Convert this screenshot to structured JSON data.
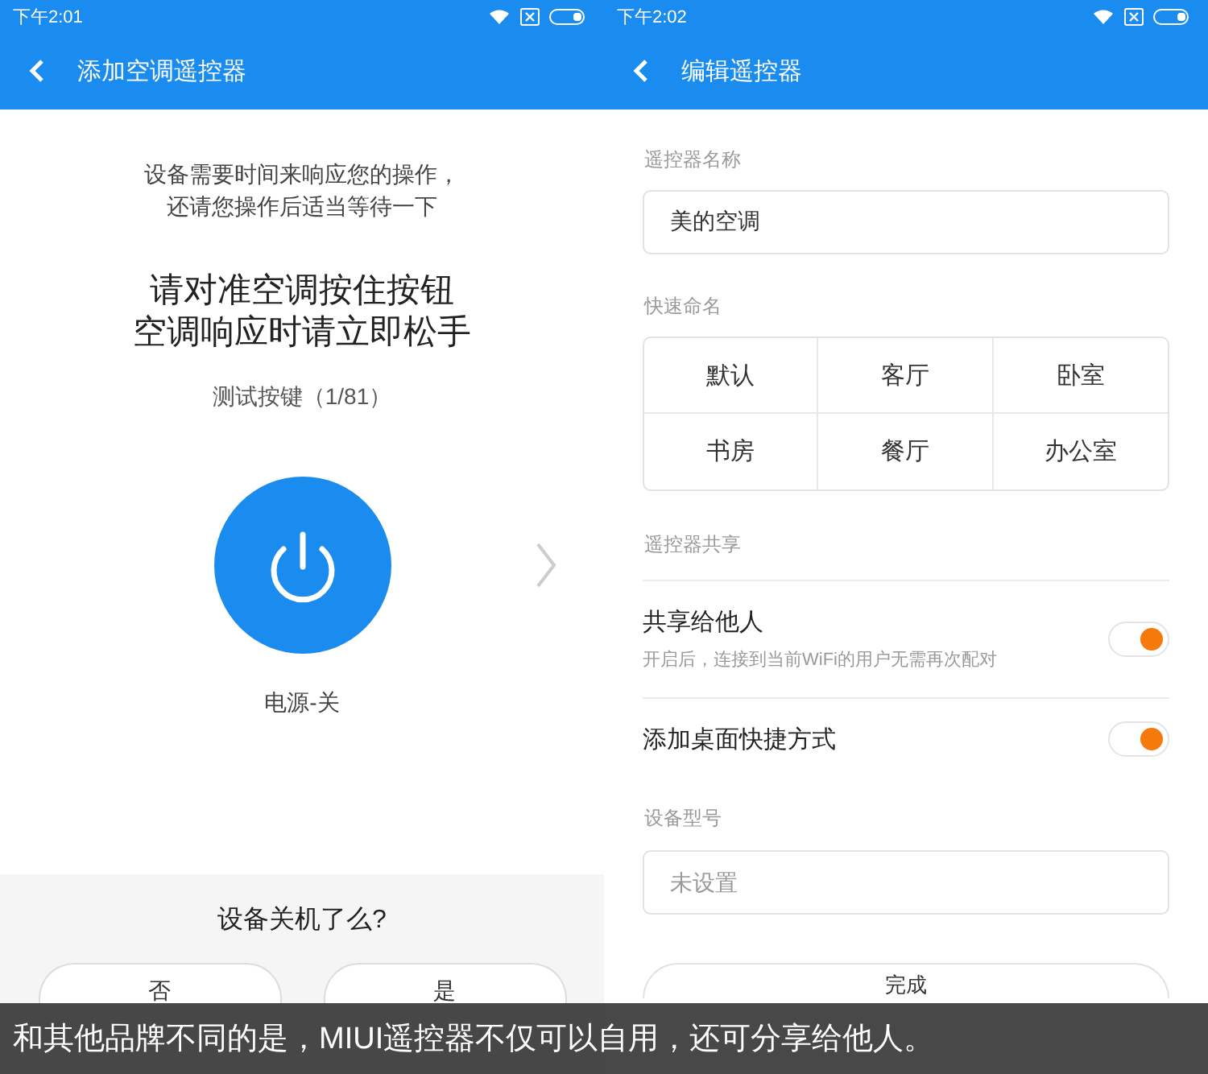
{
  "screens": [
    {
      "kind": "test",
      "status_bar": {
        "time": "下午2:01"
      },
      "title": "添加空调遥控器",
      "hint_lines": [
        "设备需要时间来响应您的操作，",
        "还请您操作后适当等待一下"
      ],
      "instruction_lines": [
        "请对准空调按住按钮",
        "空调响应时请立即松手"
      ],
      "test_label": "测试按键（1/81）",
      "key_label": "电源-关",
      "question": "设备关机了么?",
      "answers": [
        "否",
        "是"
      ]
    },
    {
      "kind": "edit",
      "status_bar": {
        "time": "下午2:02"
      },
      "title": "编辑遥控器",
      "name_label": "遥控器名称",
      "name_value": "美的空调",
      "quick_label": "快速命名",
      "quick_names": [
        "默认",
        "客厅",
        "卧室",
        "书房",
        "餐厅",
        "办公室"
      ],
      "share_label": "遥控器共享",
      "toggles": [
        {
          "label": "共享给他人",
          "sub": "开启后，连接到当前WiFi的用户无需再次配对",
          "on": true
        },
        {
          "label": "添加桌面快捷方式",
          "on": true
        }
      ],
      "model_label": "设备型号",
      "model_placeholder": "未设置",
      "done": "完成"
    }
  ],
  "caption": "和其他品牌不同的是，MIUI遥控器不仅可以自用，还可分享给他人。"
}
